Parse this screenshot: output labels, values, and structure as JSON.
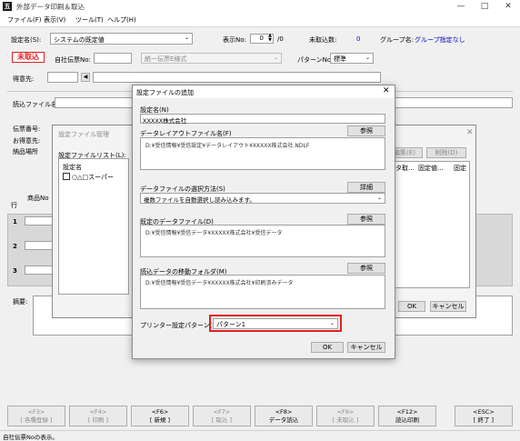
{
  "window": {
    "title": "外部データ印刷＆取込",
    "icon": "五"
  },
  "menu": [
    "ファイル(F)",
    "表示(V)",
    "ツール(T)",
    "ヘルプ(H)"
  ],
  "header": {
    "setting_label": "設定名(S):",
    "setting_value": "システムの既定値",
    "display_no_label": "表示No:",
    "display_no_value": "0",
    "display_no_total": "/0",
    "unimported_label": "未取込数:",
    "unimported_value": "0",
    "group_label": "グループ名:",
    "group_value": "グループ指定なし",
    "status_badge": "未取込",
    "company_slip_label": "自社伝票No:",
    "slip_type_value": "統一伝票E様式",
    "pattern_label": "パターンNo:",
    "pattern_value": "標準",
    "customer_label": "得意先:",
    "read_file_label": "読込ファイル名:",
    "slip_no_label": "伝票番号:",
    "customer2_label": "お得意先:",
    "delivery_label": "納品場所",
    "row_label": "行",
    "product_label": "商品No",
    "remarks_label": "摘要:",
    "rows": [
      "1",
      "2",
      "3"
    ]
  },
  "manager_dialog": {
    "title": "設定ファイル管理",
    "list_label": "設定ファイルリスト(L):",
    "column_header": "設定名",
    "item": "○△□スーパー",
    "edit_button": "編集(E)",
    "delete_button": "削除(D)",
    "col1": "ータ取...",
    "col2": "固定値...",
    "col3": "固定",
    "ok": "OK",
    "cancel": "キャンセル"
  },
  "add_dialog": {
    "title": "設定ファイルの追加",
    "name_label": "設定名(N)",
    "name_value": "XXXXX株式会社",
    "layout_label": "データレイアウトファイル名(F)",
    "layout_button": "参照",
    "layout_value": "D:¥受信情報¥受信設定¥データレイアウト¥XXXXX株式会社.NDLF",
    "select_label": "データファイルの選択方法(S)",
    "select_button": "詳細",
    "select_value": "複数ファイルを自動選択し読み込みます。",
    "default_file_label": "既定のデータファイル(D)",
    "default_file_button": "参照",
    "default_file_value": "D:¥受信情報¥受信データ¥XXXXX株式会社¥受信データ",
    "move_label": "読込データの移動フォルダ(M)",
    "move_button": "参照",
    "move_value": "D:¥受信情報¥受信データ¥XXXXX株式会社¥印刷済みデータ",
    "printer_label": "プリンター設定パターン(P):",
    "printer_value": "パターン1",
    "ok": "OK",
    "cancel": "キャンセル"
  },
  "function_keys": [
    {
      "key": "<F3>",
      "label": "[ 各種登録 ]",
      "enabled": false
    },
    {
      "key": "<F4>",
      "label": "[ 印刷 ]",
      "enabled": false
    },
    {
      "key": "<F6>",
      "label": "[ 新規 ]",
      "enabled": true
    },
    {
      "key": "<F7>",
      "label": "[ 取込 ]",
      "enabled": false
    },
    {
      "key": "<F8>",
      "label": "データ読込",
      "enabled": true
    },
    {
      "key": "<F9>",
      "label": "[ 未取込 ]",
      "enabled": false
    },
    {
      "key": "<F12>",
      "label": "読込印刷",
      "enabled": true
    },
    {
      "key": "<ESC>",
      "label": "[ 終了 ]",
      "enabled": true
    }
  ],
  "status_text": "自社伝票Noの表示。",
  "colors": {
    "accent_red": "#e02020",
    "link_blue": "#0000cc"
  }
}
